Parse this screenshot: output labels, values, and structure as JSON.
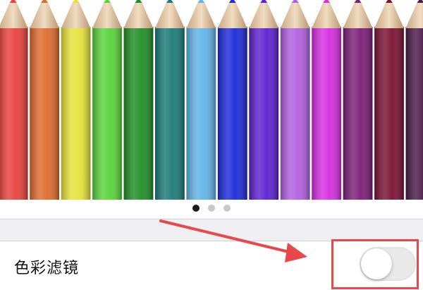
{
  "carousel": {
    "image_icon": "colored-pencils-image",
    "pencil_colors": [
      "#e8413b",
      "#dd6a2a",
      "#e6e23a",
      "#58d43a",
      "#1f8e25",
      "#1a7a78",
      "#5fb3e6",
      "#1c2ad8",
      "#5d1fd0",
      "#b05fe0",
      "#d62ee0",
      "#7a1d78",
      "#7a1232",
      "#4a1a48"
    ],
    "page_count": 3,
    "active_index": 0
  },
  "settings": {
    "color_filter_label": "色彩滤镜",
    "color_filter_enabled": false
  },
  "annotation": {
    "highlight_color": "#e8484a",
    "arrow_color": "#e8484a"
  }
}
